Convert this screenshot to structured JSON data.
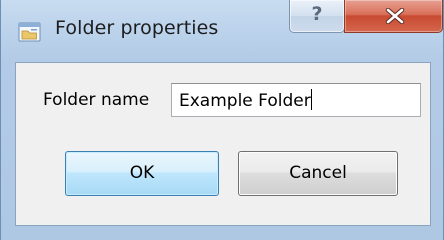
{
  "window": {
    "title": "Folder properties",
    "icon": "folder-properties-icon",
    "help_label": "?",
    "close_icon": "close-x-icon"
  },
  "form": {
    "folder_name_label": "Folder name",
    "folder_name_value": "Example Folder"
  },
  "buttons": {
    "ok_label": "OK",
    "cancel_label": "Cancel"
  },
  "colors": {
    "frame": "#bcd3ec",
    "close_button": "#c84a31",
    "ok_border": "#3c7fb1"
  }
}
